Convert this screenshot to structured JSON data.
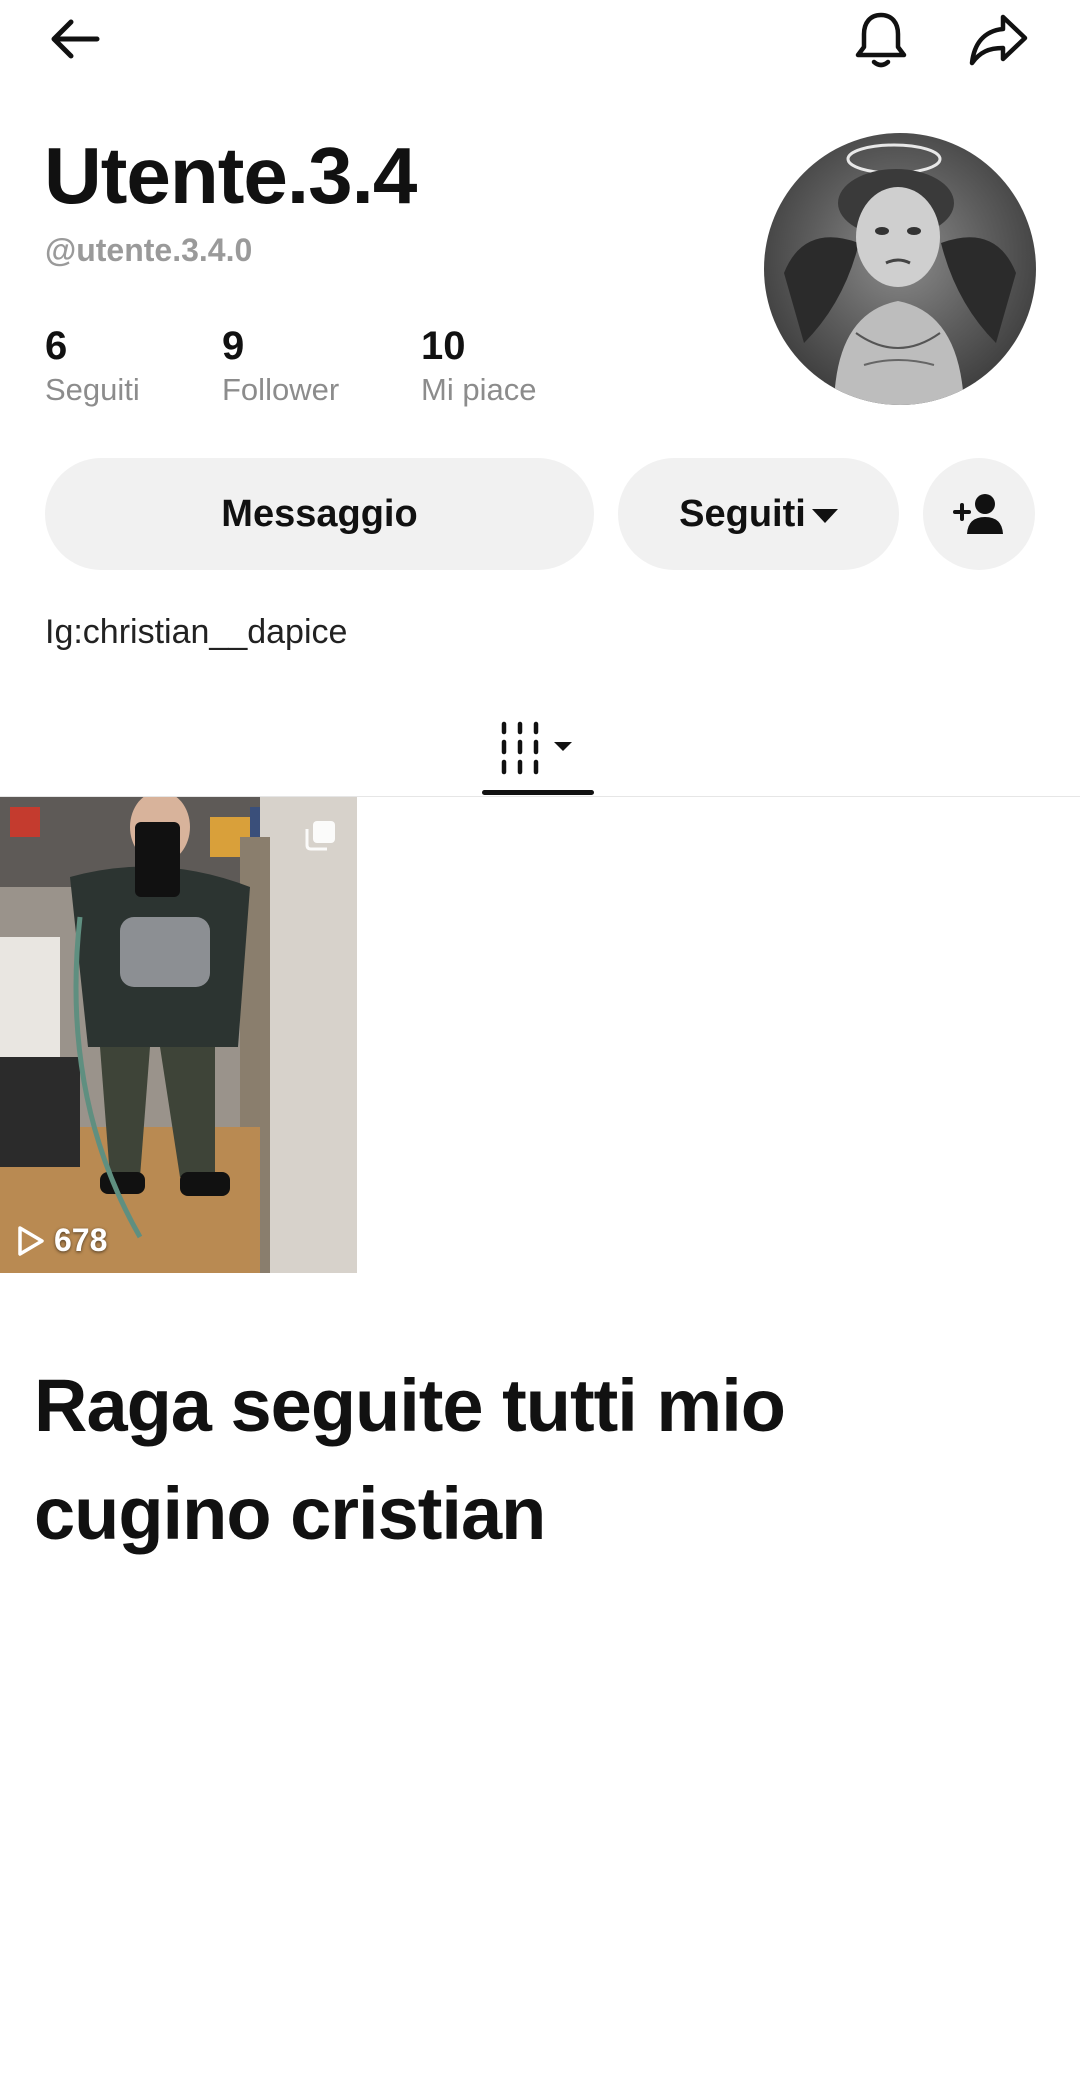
{
  "header": {
    "back_icon": "arrow-left-icon",
    "bell_icon": "bell-icon",
    "share_icon": "share-arrow-icon"
  },
  "profile": {
    "display_name": "Utente.3.4",
    "handle": "@utente.3.4.0",
    "avatar": "angel-child-avatar",
    "stats": [
      {
        "value": "6",
        "label": "Seguiti"
      },
      {
        "value": "9",
        "label": "Follower"
      },
      {
        "value": "10",
        "label": "Mi piace"
      }
    ],
    "bio": "Ig:christian__dapice"
  },
  "actions": {
    "message_label": "Messaggio",
    "following_label": "Seguiti",
    "add_user_icon": "add-user-icon"
  },
  "tabs": {
    "active_icon": "videos-grid-icon"
  },
  "videos": [
    {
      "views": "678",
      "pinned": true
    }
  ],
  "caption": "Raga seguite tutti mio cugino cristian"
}
